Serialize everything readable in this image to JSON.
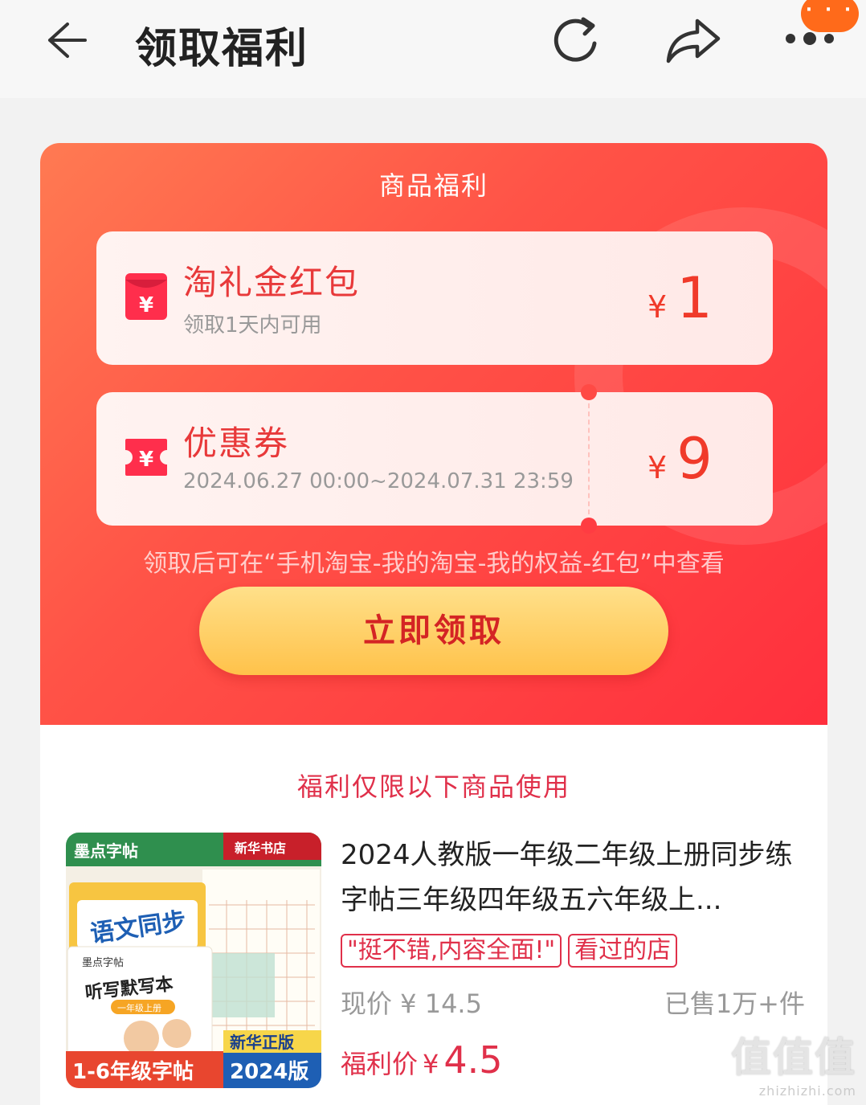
{
  "header": {
    "title": "领取福利",
    "icons": [
      "back-icon",
      "refresh-icon",
      "share-icon",
      "more-icon"
    ],
    "more_bubble": "· · ·"
  },
  "promo": {
    "title": "商品福利",
    "tickets": [
      {
        "name": "淘礼金红包",
        "sub": "领取1天内可用",
        "currency": "¥",
        "amount": "1",
        "icon": "red-envelope-icon"
      },
      {
        "name": "优惠券",
        "sub": "2024.06.27 00:00~2024.07.31 23:59",
        "currency": "¥",
        "amount": "9",
        "icon": "coupon-icon"
      }
    ],
    "note": "领取后可在“手机淘宝-我的淘宝-我的权益-红包”中查看",
    "claim_button": "立即领取"
  },
  "limit_title": "福利仅限以下商品使用",
  "product": {
    "title": "2024人教版一年级二年级上册同步练字帖三年级四年级五六年级上...",
    "tags": [
      "\"挺不错,内容全面!\"",
      "看过的店"
    ],
    "price_now": "现价 ¥ 14.5",
    "sold": "已售1万+件",
    "fuli_label": "福利价",
    "fuli_currency": "¥",
    "fuli_amount": "4.5",
    "thumb": {
      "brand": "墨点字帖",
      "store": "新华书店",
      "book1": "语文同步",
      "book2": "听写默写本",
      "book2_sub": "一年级上册",
      "badge_left": "1-6年级字帖",
      "badge_right_top": "新华正版",
      "badge_right": "2024版"
    }
  },
  "watermark": {
    "mark": "值值值",
    "url": "zhizhizhi.com"
  },
  "colors": {
    "promo_red": "#ff3c42",
    "accent": "#e0304a",
    "button_gold": "#ffc24a"
  }
}
